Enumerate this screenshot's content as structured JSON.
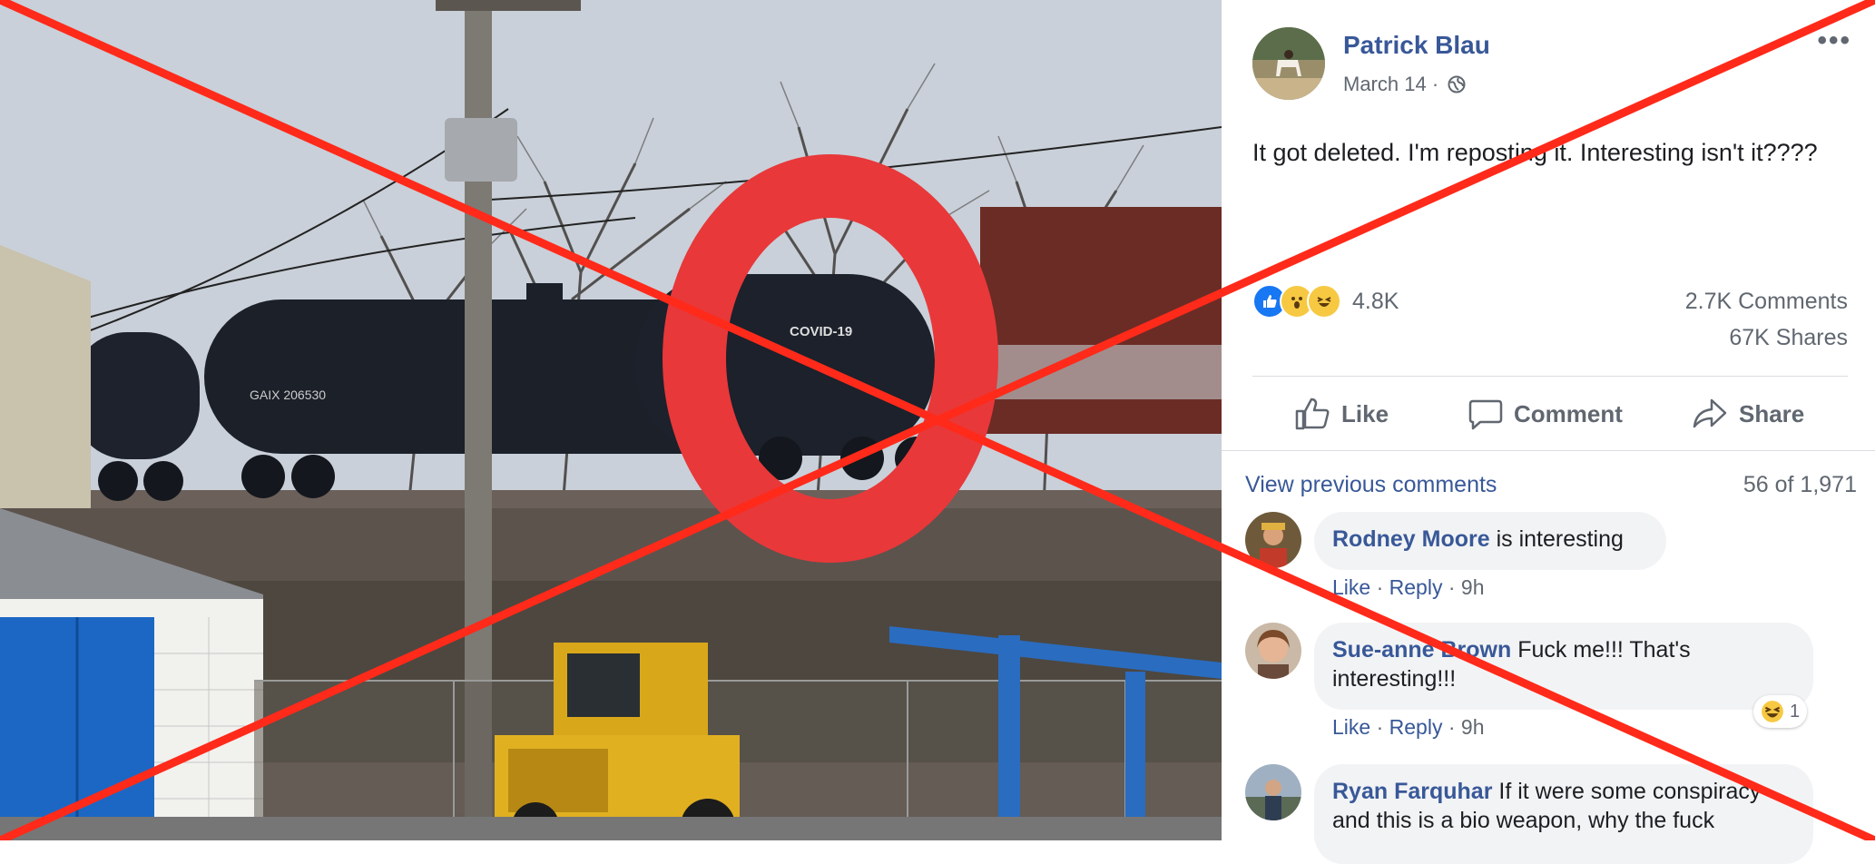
{
  "post": {
    "author": "Patrick Blau",
    "date": "March 14",
    "date_separator": "·",
    "text": "It got deleted. I'm reposting it. Interesting isn't it????",
    "more_menu": "•••",
    "reaction_count": "4.8K",
    "comments_count": "2.7K Comments",
    "shares_count": "67K Shares",
    "reaction_icons": [
      "like-icon",
      "wow-icon",
      "haha-icon"
    ]
  },
  "actions": {
    "like": "Like",
    "comment": "Comment",
    "share": "Share"
  },
  "comments_header": {
    "view_previous": "View previous comments",
    "counter": "56 of 1,971"
  },
  "comments": [
    {
      "name": "Rodney Moore",
      "text": " is interesting",
      "like": "Like",
      "reply": "Reply",
      "time": "9h"
    },
    {
      "name": "Sue-anne Brown",
      "text": " Fuck me!!! That's interesting!!!",
      "like": "Like",
      "reply": "Reply",
      "time": "9h",
      "reaction_count": "1"
    },
    {
      "name": "Ryan Farquhar",
      "text": " If it were some conspiracy and this is a bio weapon, why the fuck"
    }
  ],
  "photo": {
    "tank_car_label": "COVID-19",
    "tank_car_id": "GAIX 206530"
  },
  "colors": {
    "link_blue": "#385898",
    "meta_gray": "#606770",
    "x_red": "#ff2a1a",
    "circle_red": "#e8383a"
  }
}
